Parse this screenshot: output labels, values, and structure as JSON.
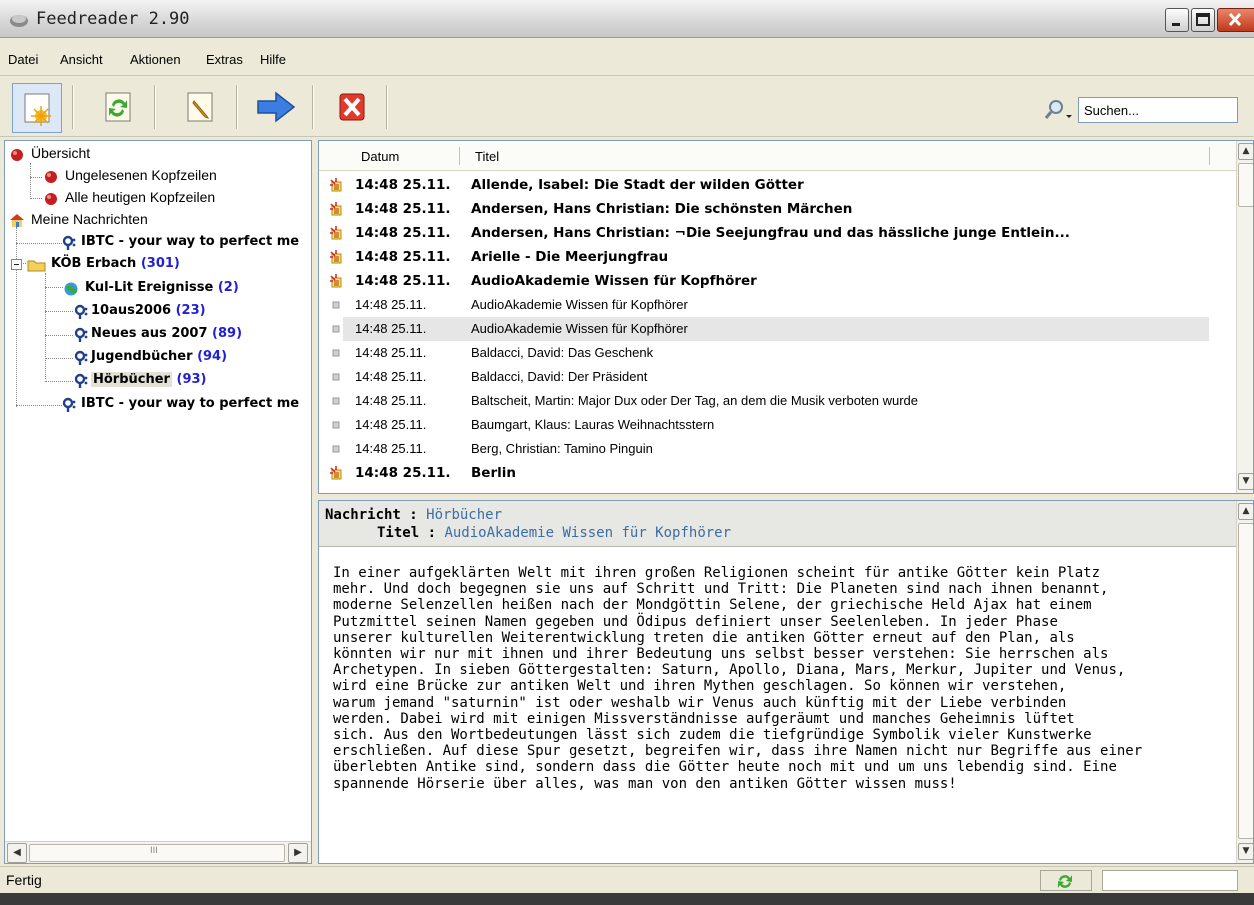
{
  "window": {
    "title": "Feedreader 2.90"
  },
  "menu": [
    "Datei",
    "Ansicht",
    "Aktionen",
    "Extras",
    "Hilfe"
  ],
  "toolbar": {
    "search_placeholder": "Suchen..."
  },
  "tree": {
    "overview": "Übersicht",
    "unread": "Ungelesenen Kopfzeilen",
    "today": "Alle heutigen Kopfzeilen",
    "my_news": "Meine Nachrichten",
    "ibtc1": "IBTC - your way to perfect me",
    "koeb": "KÖB Erbach",
    "koeb_count": "(301)",
    "kullit": "Kul-Lit Ereignisse",
    "kullit_count": "(2)",
    "aus2006": "10aus2006",
    "aus2006_count": "(23)",
    "neues": "Neues aus 2007",
    "neues_count": "(89)",
    "jugend": "Jugendbücher",
    "jugend_count": "(94)",
    "hoer": "Hörbücher",
    "hoer_count": "(93)",
    "ibtc2": "IBTC - your way to perfect me"
  },
  "list": {
    "col_date": "Datum",
    "col_title": "Titel",
    "rows": [
      {
        "date": "14:48 25.11.",
        "title": "Allende, Isabel: Die Stadt der wilden Götter",
        "unread": true
      },
      {
        "date": "14:48 25.11.",
        "title": "Andersen, Hans Christian: Die schönsten Märchen",
        "unread": true
      },
      {
        "date": "14:48 25.11.",
        "title": "Andersen, Hans Christian: ¬Die Seejungfrau und das hässliche junge Entlein...",
        "unread": true
      },
      {
        "date": "14:48 25.11.",
        "title": "Arielle - Die Meerjungfrau",
        "unread": true
      },
      {
        "date": "14:48 25.11.",
        "title": "AudioAkademie Wissen für Kopfhörer",
        "unread": true
      },
      {
        "date": "14:48 25.11.",
        "title": "AudioAkademie Wissen für Kopfhörer",
        "unread": false
      },
      {
        "date": "14:48 25.11.",
        "title": "AudioAkademie Wissen für Kopfhörer",
        "unread": false,
        "selected": true
      },
      {
        "date": "14:48 25.11.",
        "title": "Baldacci, David: Das Geschenk",
        "unread": false
      },
      {
        "date": "14:48 25.11.",
        "title": "Baldacci, David: Der Präsident",
        "unread": false
      },
      {
        "date": "14:48 25.11.",
        "title": "Baltscheit, Martin:  Major Dux oder Der Tag, an dem die Musik verboten wurde",
        "unread": false
      },
      {
        "date": "14:48 25.11.",
        "title": "Baumgart, Klaus:  Lauras Weihnachtsstern",
        "unread": false
      },
      {
        "date": "14:48 25.11.",
        "title": "Berg, Christian:  Tamino Pinguin",
        "unread": false
      },
      {
        "date": "14:48 25.11.",
        "title": "Berlin",
        "unread": true
      }
    ]
  },
  "detail": {
    "label_message": "Nachricht :",
    "message": "Hörbücher",
    "label_title": "Titel :",
    "title": "AudioAkademie Wissen für Kopfhörer",
    "body": "In einer aufgeklärten Welt mit ihren großen Religionen scheint für antike Götter kein Platz\nmehr. Und doch begegnen sie uns auf Schritt und Tritt: Die Planeten sind nach ihnen benannt,\nmoderne Selenzellen heißen nach der Mondgöttin Selene, der griechische Held Ajax hat einem\nPutzmittel seinen Namen gegeben und Ödipus definiert unser Seelenleben. In jeder Phase\nunserer kulturellen Weiterentwicklung treten die antiken Götter erneut auf den Plan, als\nkönnten wir nur mit ihnen und ihrer Bedeutung uns selbst besser verstehen: Sie herrschen als\nArchetypen. In sieben Göttergestalten: Saturn, Apollo, Diana, Mars, Merkur, Jupiter und Venus,\nwird eine Brücke zur antiken Welt und ihren Mythen geschlagen. So können wir verstehen,\nwarum jemand \"saturnin\" ist oder weshalb wir Venus auch künftig mit der Liebe verbinden\nwerden. Dabei wird mit einigen Missverständnisse aufgeräumt und manches Geheimnis lüftet\nsich. Aus den Wortbedeutungen lässt sich zudem die tiefgründige Symbolik vieler Kunstwerke\nerschließen. Auf diese Spur gesetzt, begreifen wir, dass ihre Namen nicht nur Begriffe aus einer\nüberlebten Antike sind, sondern dass die Götter heute noch mit und um uns lebendig sind. Eine\nspannende Hörserie über alles, was man von den antiken Götter wissen muss!"
  },
  "status": {
    "text": "Fertig"
  },
  "icons": {
    "new_feed": "new-feed-icon",
    "refresh": "refresh-icon",
    "edit": "pencil-icon",
    "next": "arrow-right-icon",
    "delete": "delete-icon",
    "search": "search-icon"
  },
  "colors": {
    "count": "#1f1fd6",
    "detail_value": "#3b6ea5",
    "selection": "#e6e6e6"
  }
}
